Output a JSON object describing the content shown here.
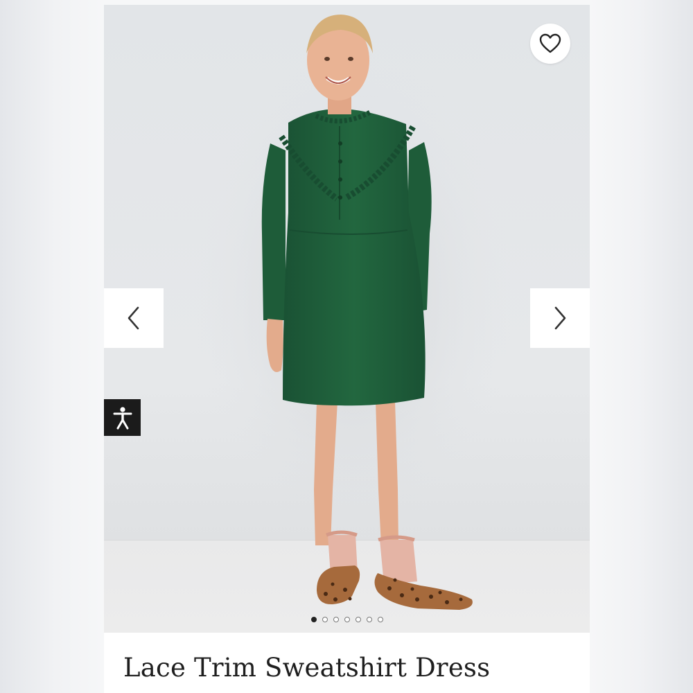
{
  "product": {
    "title": "Lace Trim Sweatshirt Dress",
    "image_description_icon": "product-photo",
    "gallery": {
      "total_images": 7,
      "active_index": 0
    }
  },
  "icons": {
    "favorite": "heart-outline-icon",
    "previous": "chevron-left-icon",
    "next": "chevron-right-icon",
    "accessibility": "accessibility-person-icon"
  },
  "colors": {
    "dress": "#1f5f3c",
    "accessibility_bg": "#1b1b1b",
    "card_bg": "#ffffff",
    "title_text": "#1e1e1e"
  }
}
